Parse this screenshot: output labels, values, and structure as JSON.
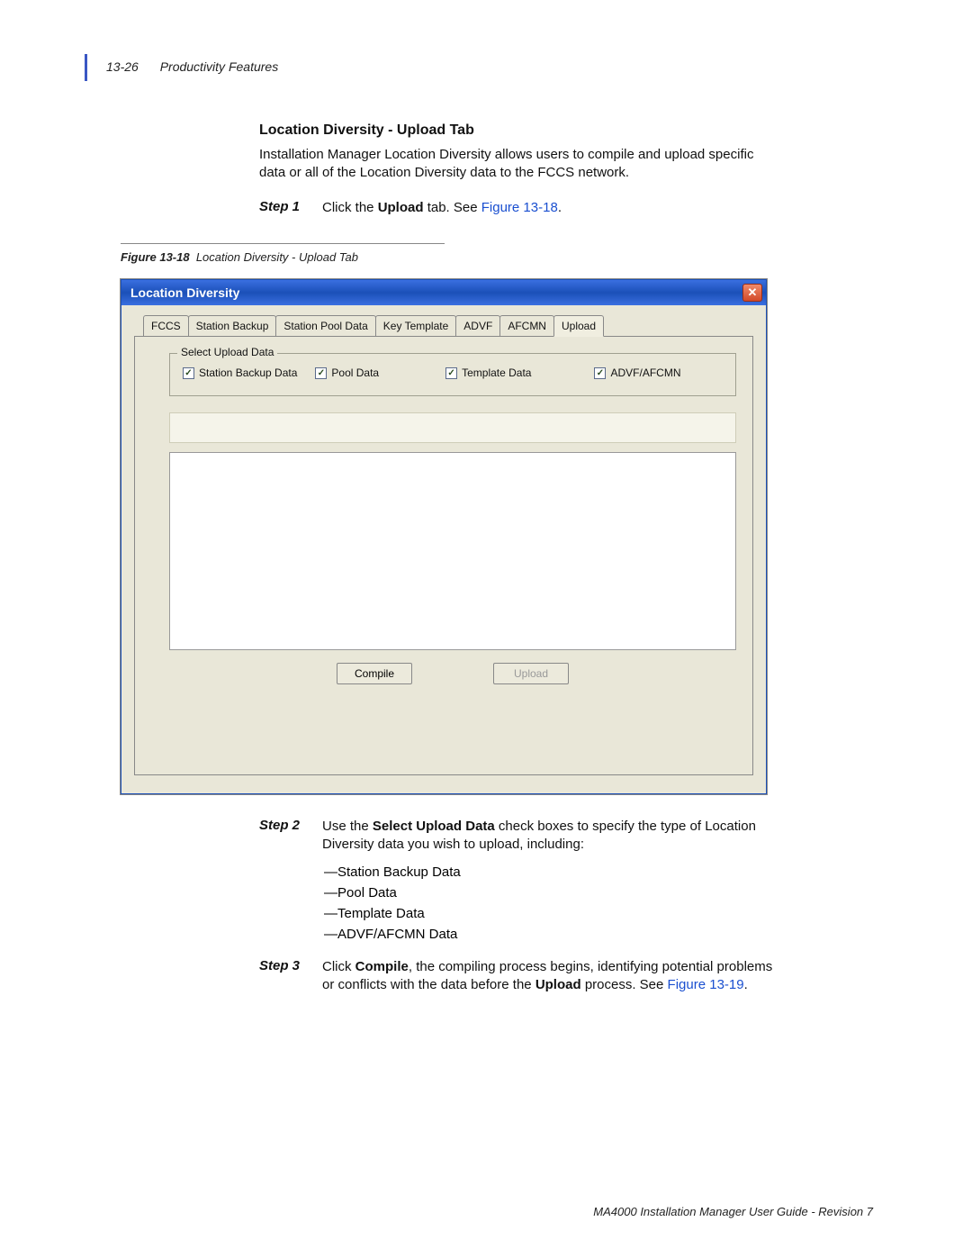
{
  "running_head": {
    "page_num": "13-26",
    "section": "Productivity Features"
  },
  "section_title": "Location Diversity - Upload Tab",
  "intro": "Installation Manager Location Diversity allows users to compile and upload specific data or all of the Location Diversity data to the FCCS network.",
  "step1": {
    "label": "Step 1",
    "pre": "Click the ",
    "bold": "Upload",
    "post": " tab. See ",
    "figref": "Figure 13-18",
    "tail": "."
  },
  "figure_caption": {
    "num": "Figure 13-18",
    "title": "Location Diversity - Upload Tab"
  },
  "window": {
    "title": "Location Diversity",
    "close_glyph": "✕",
    "tabs": [
      "FCCS",
      "Station Backup",
      "Station Pool Data",
      "Key Template",
      "ADVF",
      "AFCMN",
      "Upload"
    ],
    "active_tab_index": 6,
    "groupbox_legend": "Select Upload Data",
    "checkboxes": [
      {
        "label": "Station Backup Data",
        "checked": true
      },
      {
        "label": "Pool Data",
        "checked": true
      },
      {
        "label": "Template Data",
        "checked": true
      },
      {
        "label": "ADVF/AFCMN",
        "checked": true
      }
    ],
    "buttons": {
      "compile": "Compile",
      "upload": "Upload"
    }
  },
  "step2": {
    "label": "Step 2",
    "pre": "Use the ",
    "bold": "Select Upload Data",
    "post": " check boxes to specify the type of Location Diversity data you wish to upload, including:",
    "bullets": [
      "Station Backup Data",
      "Pool Data",
      "Template Data",
      "ADVF/AFCMN Data"
    ]
  },
  "step3": {
    "label": "Step 3",
    "pre": "Click ",
    "bold1": "Compile",
    "mid": ", the compiling process begins, identifying potential problems or conflicts with the data before the ",
    "bold2": "Upload",
    "post": " process. See ",
    "figref": "Figure 13-19",
    "tail": "."
  },
  "footer": "MA4000 Installation Manager User Guide - Revision 7"
}
